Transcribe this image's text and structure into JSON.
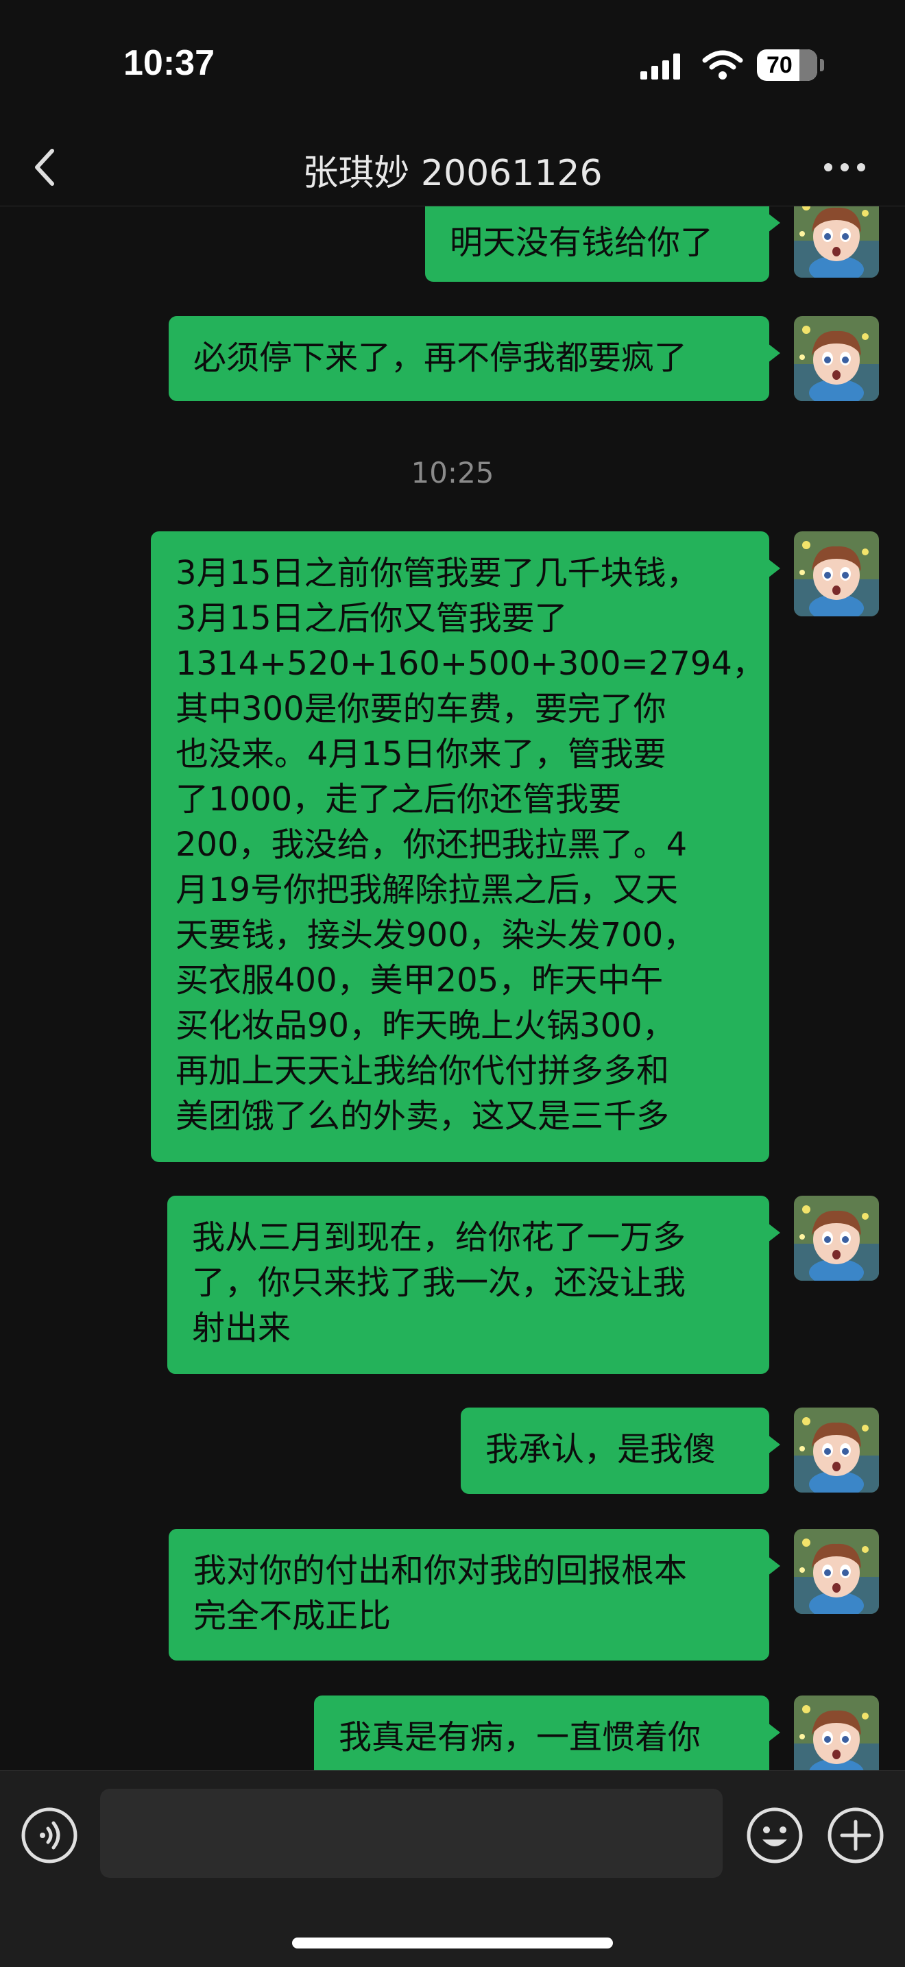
{
  "status_bar": {
    "time": "10:37",
    "battery": "70"
  },
  "header": {
    "back_icon": "chevron-left-icon",
    "title": "张琪妙 20061126",
    "more_icon": "more-dots-icon"
  },
  "messages": [
    {
      "sender": "self",
      "text": "明天没有钱给你了"
    },
    {
      "sender": "self",
      "text": "必须停下来了，再不停我都要疯了"
    },
    {
      "time_divider": "10:25"
    },
    {
      "sender": "self",
      "text": "3月15日之前你管我要了几千块钱，\n3月15日之后你又管我要了\n1314+520+160+500+300=2794，\n其中300是你要的车费，要完了你\n也没来。4月15日你来了，管我要\n了1000，走了之后你还管我要\n200，我没给，你还把我拉黑了。4\n月19号你把我解除拉黑之后，又天\n天要钱，接头发900，染头发700，\n买衣服400，美甲205，昨天中午\n买化妆品90，昨天晚上火锅300，\n再加上天天让我给你代付拼多多和\n美团饿了么的外卖，这又是三千多"
    },
    {
      "sender": "self",
      "text": "我从三月到现在，给你花了一万多\n了，你只来找了我一次，还没让我\n射出来"
    },
    {
      "sender": "self",
      "text": "我承认，是我傻"
    },
    {
      "sender": "self",
      "text": "我对你的付出和你对我的回报根本\n完全不成正比"
    },
    {
      "sender": "self",
      "text": "我真是有病，一直惯着你"
    }
  ],
  "input_bar": {
    "voice_icon": "voice-icon",
    "input_value": "",
    "emoji_icon": "emoji-icon",
    "plus_icon": "plus-icon"
  },
  "colors": {
    "background": "#111111",
    "bubble_self": "#24b25a",
    "input_bar": "#1e1e1e"
  }
}
